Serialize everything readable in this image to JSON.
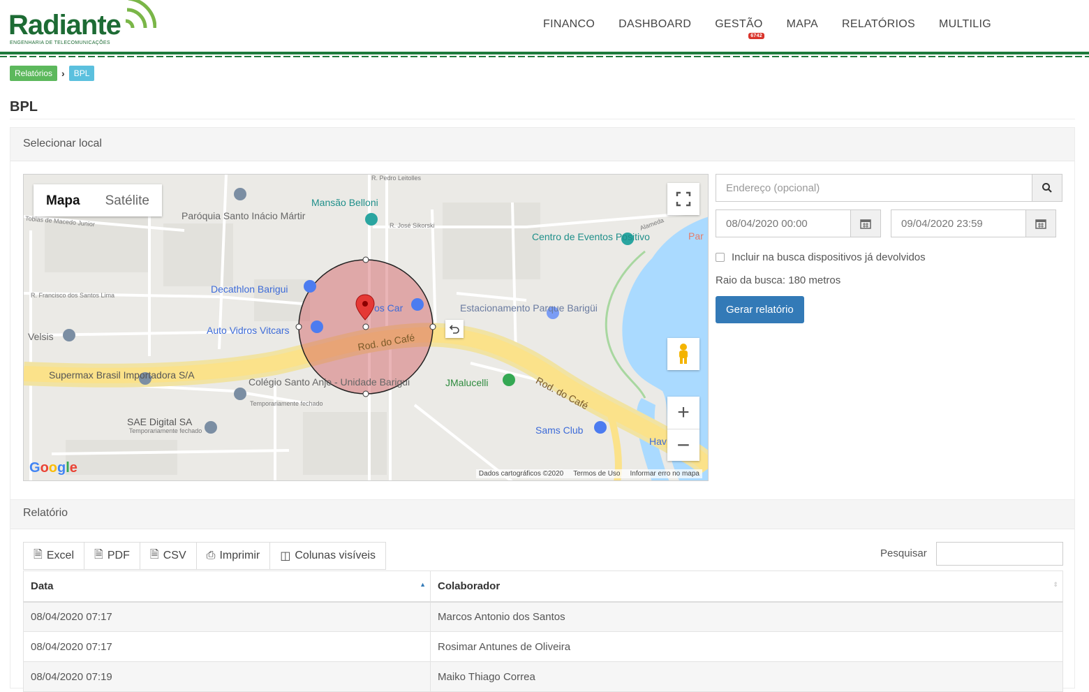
{
  "brand": {
    "name": "Radiante",
    "tagline": "ENGENHARIA DE TELECOMUNICAÇÕES",
    "color": "#1d6b34"
  },
  "nav": {
    "items": [
      "FINANCO",
      "DASHBOARD",
      "GESTÃO",
      "MAPA",
      "RELATÓRIOS",
      "MULTILIG"
    ],
    "gestao_badge": "6742"
  },
  "breadcrumb": {
    "parent": "Relatórios",
    "current": "BPL"
  },
  "page_title": "BPL",
  "local_panel": {
    "heading": "Selecionar local",
    "map": {
      "type_map": "Mapa",
      "type_satellite": "Satélite",
      "logo": "Google",
      "footer": [
        "Dados cartográficos ©2020",
        "Termos de Uso",
        "Informar erro no mapa"
      ],
      "places": {
        "parish": "Paróquia Santo Inácio Mártir",
        "mansion": "Mansão Belloni",
        "centro": "Centro de Eventos Positivo",
        "decathlon": "Decathlon Barigui",
        "estacionamento": "Estacionamento Parque Barigüi",
        "oscar": "os Car",
        "auto_vidros": "Auto Vidros Vitcars",
        "velsis": "Velsis",
        "supermax": "Supermax Brasil Importadora S/A",
        "colegio": "Colégio Santo Anjo - Unidade Barigui",
        "colegio_note": "Temporariamente fechado",
        "jmalucelli": "JMalucelli",
        "sae": "SAE Digital SA",
        "sae_note": "Temporariamente fechado",
        "sams": "Sams Club",
        "rod_cafe_1": "Rod. do Café",
        "rod_cafe_2": "Rod. do Café",
        "hav": "Hav",
        "par": "Par"
      },
      "streets": {
        "pedro": "R. Pedro Leitolles",
        "jose_sikorski": "R. José Sikorski",
        "tobias": "Tobias de Macedo Junior",
        "francisco": "R. Francisco dos Santos Lima",
        "alameda": "Alameda"
      }
    },
    "address_placeholder": "Endereço (opcional)",
    "date_start": "08/04/2020 00:00",
    "date_end": "09/04/2020 23:59",
    "include_returned_label": "Incluir na busca dispositivos já devolvidos",
    "radius_text": "Raio da busca: 180 metros",
    "generate_button": "Gerar relatório"
  },
  "report_panel": {
    "heading": "Relatório",
    "tools": {
      "excel": "Excel",
      "pdf": "PDF",
      "csv": "CSV",
      "print": "Imprimir",
      "columns": "Colunas visíveis"
    },
    "search_label": "Pesquisar",
    "columns": [
      "Data",
      "Colaborador"
    ],
    "rows": [
      [
        "08/04/2020 07:17",
        "Marcos Antonio dos Santos"
      ],
      [
        "08/04/2020 07:17",
        "Rosimar Antunes de Oliveira"
      ],
      [
        "08/04/2020 07:19",
        "Maiko Thiago Correa"
      ]
    ]
  },
  "colors": {
    "accent_green": "#1e7a3c",
    "primary": "#337ab7",
    "badge_red": "#d9342b",
    "crumb_green": "#5cb85c",
    "crumb_blue": "#5bc0de"
  }
}
